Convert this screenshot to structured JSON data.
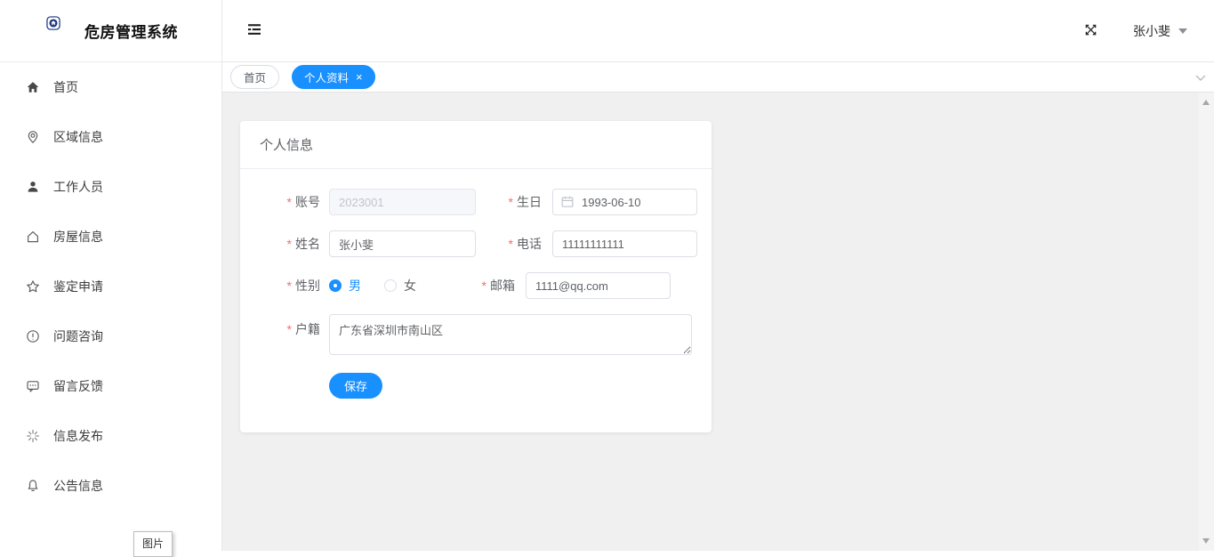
{
  "app": {
    "title": "危房管理系统"
  },
  "header": {
    "user_name": "张小斐"
  },
  "tab_bar": {
    "tabs": [
      {
        "label": "首页",
        "active": false
      },
      {
        "label": "个人资料",
        "active": true,
        "close_glyph": "×"
      }
    ]
  },
  "sidebar": {
    "items": [
      {
        "label": "首页",
        "icon": "home-icon"
      },
      {
        "label": "区域信息",
        "icon": "location-icon"
      },
      {
        "label": "工作人员",
        "icon": "person-icon"
      },
      {
        "label": "房屋信息",
        "icon": "house-icon"
      },
      {
        "label": "鉴定申请",
        "icon": "star-icon"
      },
      {
        "label": "问题咨询",
        "icon": "exclamation-circle-icon"
      },
      {
        "label": "留言反馈",
        "icon": "message-icon"
      },
      {
        "label": "信息发布",
        "icon": "loading-icon"
      },
      {
        "label": "公告信息",
        "icon": "bell-icon"
      }
    ],
    "tooltip_label": "图片"
  },
  "profile_form": {
    "title": "个人信息",
    "fields": {
      "account": {
        "label": "账号",
        "value": "2023001",
        "disabled": true
      },
      "birthday": {
        "label": "生日",
        "value": "1993-06-10"
      },
      "name": {
        "label": "姓名",
        "value": "张小斐"
      },
      "phone": {
        "label": "电话",
        "value": "11111111111"
      },
      "gender": {
        "label": "性别",
        "options": [
          "男",
          "女"
        ],
        "selected": "男"
      },
      "email": {
        "label": "邮箱",
        "value": "1111@qq.com"
      },
      "residence": {
        "label": "户籍",
        "value": "广东省深圳市南山区"
      }
    },
    "save_label": "保存"
  },
  "colors": {
    "accent": "#1890ff",
    "logo_navy": "#1a337e",
    "required": "#f56c6c"
  }
}
